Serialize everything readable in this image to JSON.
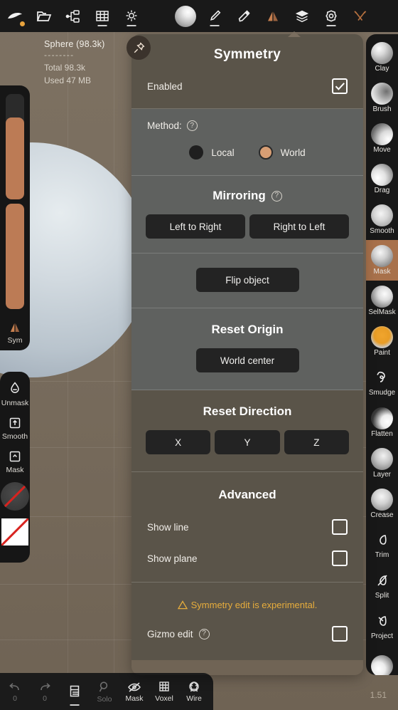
{
  "app": {
    "version_label": "1.51",
    "accent": "#c8804f",
    "panel_warm": "#5a5449",
    "panel_cool": "#5f615f",
    "viewport_bg": "#776b5c",
    "warning_color": "#e7ad3c"
  },
  "topbar": {
    "items": [
      {
        "name": "sculpt-logo-icon",
        "label": ""
      },
      {
        "name": "folder-icon",
        "label": ""
      },
      {
        "name": "scene-graph-icon",
        "label": ""
      },
      {
        "name": "grid-icon",
        "label": ""
      },
      {
        "name": "light-icon",
        "label": ""
      },
      {
        "name": "material-ball-icon",
        "label": ""
      },
      {
        "name": "brush-icon",
        "label": ""
      },
      {
        "name": "paint-bucket-icon",
        "label": ""
      },
      {
        "name": "symmetry-icon",
        "label": ""
      },
      {
        "name": "layers-icon",
        "label": ""
      },
      {
        "name": "settings-gear-icon",
        "label": ""
      },
      {
        "name": "tools-icon",
        "label": ""
      }
    ]
  },
  "info": {
    "object": "Sphere (98.3k)",
    "divider": "--------",
    "total": "Total 98.3k",
    "used": "Used 47 MB"
  },
  "left_toolbar": {
    "slider_top_value": 78,
    "slider_bottom_value": 100,
    "symmetry": {
      "label": "Sym",
      "icon": "symmetry-icon"
    },
    "tools": [
      {
        "label": "Unmask",
        "icon": "unmask-drop-icon"
      },
      {
        "label": "Smooth",
        "icon": "smooth-arrow-up-icon"
      },
      {
        "label": "Mask",
        "icon": "mask-arrow-icon"
      }
    ],
    "color_swatch_circle": "circle-no-color-swatch",
    "color_swatch_square": "square-no-color-swatch"
  },
  "right_toolbar": {
    "active": "Mask",
    "tools": [
      {
        "label": "Clay",
        "icon": "clay-brush-icon",
        "ball": "clay"
      },
      {
        "label": "Brush",
        "icon": "brush-tool-icon",
        "ball": "brush"
      },
      {
        "label": "Move",
        "icon": "move-tool-icon",
        "ball": "move"
      },
      {
        "label": "Drag",
        "icon": "drag-tool-icon",
        "ball": "drag"
      },
      {
        "label": "Smooth",
        "icon": "smooth-tool-icon",
        "ball": "smooth"
      },
      {
        "label": "Mask",
        "icon": "mask-tool-icon",
        "ball": "mask"
      },
      {
        "label": "SelMask",
        "icon": "select-mask-icon",
        "ball": "selmask"
      },
      {
        "label": "Paint",
        "icon": "paint-tool-icon",
        "ball": "paint"
      },
      {
        "label": "Smudge",
        "icon": "smudge-tool-icon",
        "ball": ""
      },
      {
        "label": "Flatten",
        "icon": "flatten-tool-icon",
        "ball": "flatten"
      },
      {
        "label": "Layer",
        "icon": "layer-tool-icon",
        "ball": "layer"
      },
      {
        "label": "Crease",
        "icon": "crease-tool-icon",
        "ball": "crease"
      },
      {
        "label": "Trim",
        "icon": "trim-tool-icon",
        "ball": ""
      },
      {
        "label": "Split",
        "icon": "split-tool-icon",
        "ball": ""
      },
      {
        "label": "Project",
        "icon": "project-tool-icon",
        "ball": ""
      },
      {
        "label": "",
        "icon": "more-tool-icon",
        "ball": "last"
      }
    ]
  },
  "panel": {
    "pin_icon": "pin-icon",
    "title": "Symmetry",
    "enabled": {
      "label": "Enabled",
      "checked": true
    },
    "method": {
      "label": "Method:",
      "help": "?",
      "options": [
        {
          "label": "Local",
          "selected": false
        },
        {
          "label": "World",
          "selected": true
        }
      ]
    },
    "mirroring": {
      "title": "Mirroring",
      "help": "?",
      "buttons": [
        "Left to Right",
        "Right to Left"
      ],
      "flip": "Flip object"
    },
    "reset_origin": {
      "title": "Reset Origin",
      "button": "World center"
    },
    "reset_direction": {
      "title": "Reset Direction",
      "buttons": [
        "X",
        "Y",
        "Z"
      ]
    },
    "advanced": {
      "title": "Advanced",
      "show_line": {
        "label": "Show line",
        "checked": false
      },
      "show_plane": {
        "label": "Show plane",
        "checked": false
      },
      "warning": "Symmetry edit is experimental.",
      "gizmo_edit": {
        "label": "Gizmo edit",
        "help": "?",
        "checked": false
      }
    }
  },
  "bottombar": {
    "items": [
      {
        "label": "0",
        "icon": "undo-icon",
        "dim": true
      },
      {
        "label": "0",
        "icon": "redo-icon",
        "dim": true
      },
      {
        "label": "",
        "icon": "layers-list-icon",
        "dim": false
      },
      {
        "label": "Solo",
        "icon": "solo-search-icon",
        "dim": true
      },
      {
        "label": "Mask",
        "icon": "mask-eye-off-icon",
        "dim": false
      },
      {
        "label": "Voxel",
        "icon": "voxel-grid-icon",
        "dim": false
      },
      {
        "label": "Wire",
        "icon": "wireframe-icon",
        "dim": false
      }
    ]
  }
}
